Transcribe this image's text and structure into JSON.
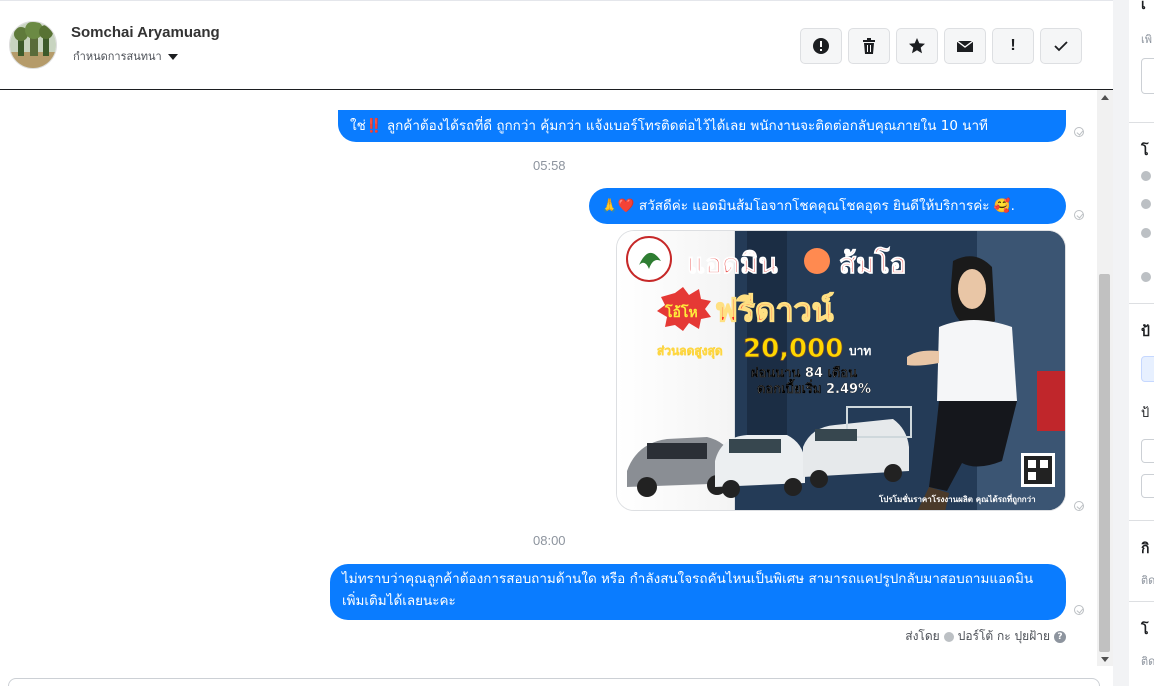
{
  "header": {
    "contact_name": "Somchai Aryamuang",
    "assign_label": "กำหนดการสนทนา"
  },
  "toolbar": [
    {
      "icon": "alert-circle-icon"
    },
    {
      "icon": "trash-icon"
    },
    {
      "icon": "star-icon"
    },
    {
      "icon": "envelope-icon"
    },
    {
      "icon": "exclamation-icon",
      "label": "!"
    },
    {
      "icon": "checkmark-icon"
    }
  ],
  "messages": [
    {
      "text": "ใช่‼️ ลูกค้าต้องได้รถที่ดี ถูกกว่า คุ้มกว่า แจ้งเบอร์โทรติดต่อไว้ได้เลย พนักงานจะติดต่อกลับคุณภายใน 10 นาที"
    },
    {
      "timestamp": "05:58"
    },
    {
      "text": "🙏❤️ สวัสดีค่ะ แอดมินส้มโอจากโชคคุณโชคอุดร ยินดีให้บริการค่ะ 🥰."
    },
    {
      "timestamp": "08:00"
    },
    {
      "text": "ไม่ทราบว่าคุณลูกค้าต้องการสอบถามด้านใด หรือ กำลังสนใจรถคันไหนเป็นพิเศษ สามารถแคปรูปกลับมาสอบถามแอดมินเพิ่มเติมได้เลยนะคะ"
    }
  ],
  "promo_image": {
    "headline": "แอดมิน",
    "headline2": "ส้มโอ",
    "badge": "โอ้โห",
    "title": "ฟรีดาวน์",
    "discount_label": "ส่วนลดสูงสุด",
    "discount_value": "20,000",
    "discount_unit": "บาท",
    "installment": "ผ่อนนาน 84 เดือน",
    "interest": "ดอกเบี้ยเริ่ม 2.49%",
    "footer": "โปรโมชั่นราคาโรงงานผลิต คุณได้รถที่ถูกกว่า"
  },
  "sent_by": {
    "prefix": "ส่งโดย",
    "name": "ปอร์โต้ กะ ปุยฝ้าย",
    "help": "?"
  },
  "right_panel": {
    "heading1": "เ",
    "small1": "เพิ",
    "heading2": "โ",
    "heading3": "ป้",
    "small3": "ป้",
    "heading4": "กิ",
    "small4": "ติด",
    "heading5": "โ",
    "small5": "ติด"
  },
  "colors": {
    "bubble": "#0a7cff",
    "header_border": "#1c1e21",
    "timestamp": "#8d949e"
  }
}
